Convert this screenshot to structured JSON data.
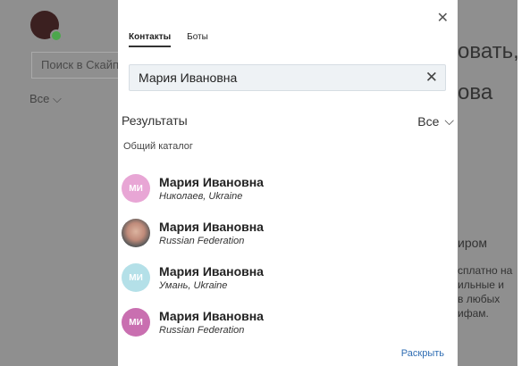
{
  "background": {
    "search_placeholder": "Поиск в Скайп",
    "filter_label": "Все",
    "title_line1": "овать,",
    "title_line2": "ова",
    "subtitle": "иром",
    "body_text": "сплатно на\nильные и\nв любых\nифам."
  },
  "dialog": {
    "tabs": [
      "Контакты",
      "Боты"
    ],
    "search_value": "Мария Ивановна",
    "results_label": "Результаты",
    "filter_label": "Все",
    "catalog_label": "Общий каталог",
    "expand_label": "Раскрыть",
    "results": [
      {
        "initials": "МИ",
        "name": "Мария Ивановна",
        "location": "Николаев, Ukraine",
        "avatar_style": "pink"
      },
      {
        "initials": "",
        "name": "Мария Ивановна",
        "location": "Russian Federation",
        "avatar_style": "photo"
      },
      {
        "initials": "МИ",
        "name": "Мария Ивановна",
        "location": "Умань, Ukraine",
        "avatar_style": "light"
      },
      {
        "initials": "МИ",
        "name": "Мария Ивановна",
        "location": "Russian Federation",
        "avatar_style": "magenta"
      }
    ]
  },
  "icons": {
    "close": "close-icon",
    "clear": "clear-icon",
    "chevron": "chevron-down-icon"
  }
}
